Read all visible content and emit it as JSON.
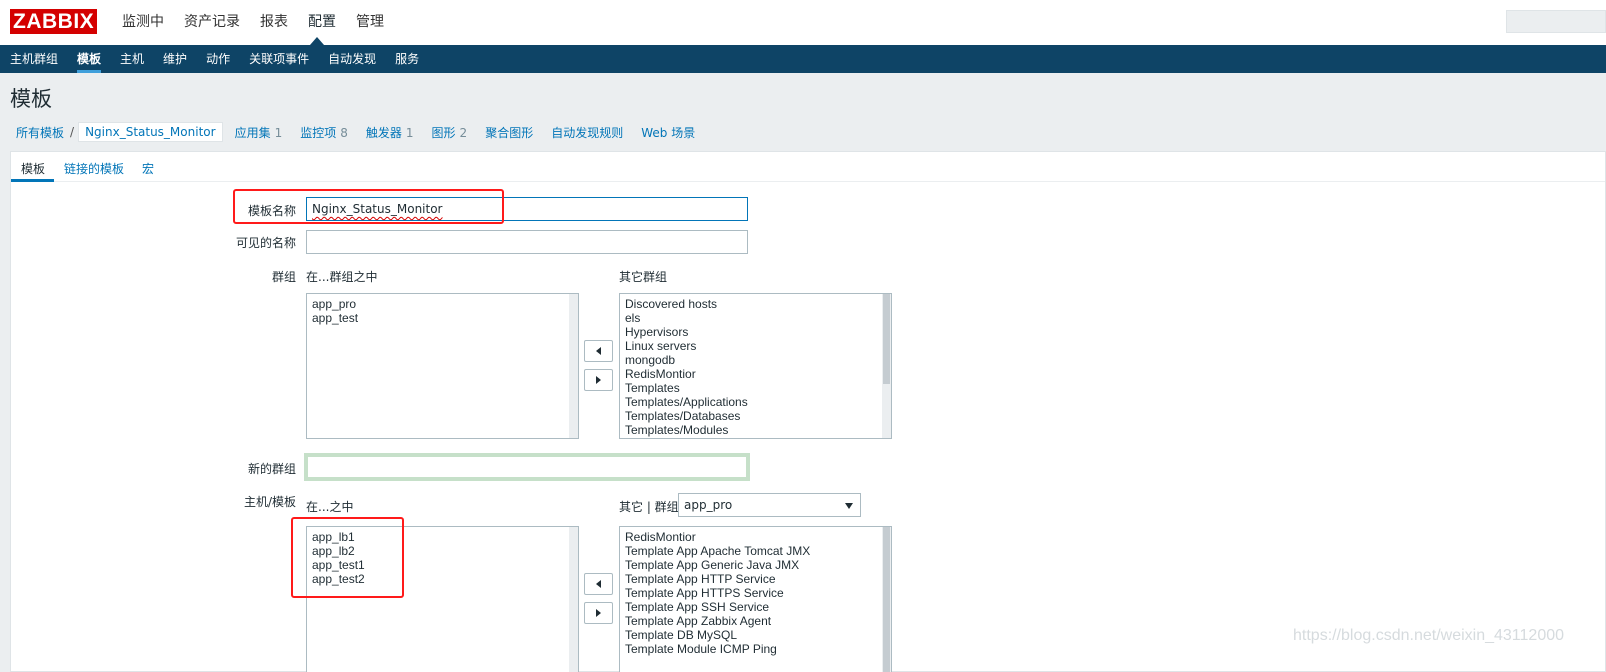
{
  "app": {
    "logo": "ZABBIX"
  },
  "top_menu": {
    "items": [
      "监测中",
      "资产记录",
      "报表",
      "配置",
      "管理"
    ],
    "selected": "配置"
  },
  "sub_menu": {
    "items": [
      "主机群组",
      "模板",
      "主机",
      "维护",
      "动作",
      "关联项事件",
      "自动发现",
      "服务"
    ],
    "selected": "模板"
  },
  "page": {
    "title": "模板"
  },
  "nav": {
    "all_templates": "所有模板",
    "separator": "/",
    "current_template": "Nginx_Status_Monitor",
    "applications": {
      "label": "应用集",
      "count": "1"
    },
    "items": {
      "label": "监控项",
      "count": "8"
    },
    "triggers": {
      "label": "触发器",
      "count": "1"
    },
    "graphs": {
      "label": "图形",
      "count": "2"
    },
    "screens": "聚合图形",
    "discovery": "自动发现规则",
    "web": "Web 场景"
  },
  "tabs": [
    "模板",
    "链接的模板",
    "宏"
  ],
  "form": {
    "template_name": {
      "label": "模板名称",
      "value": "Nginx_Status_Monitor"
    },
    "visible_name": {
      "label": "可见的名称",
      "value": ""
    },
    "groups": {
      "label": "群组",
      "in_label": "在...群组之中",
      "other_label": "其它群组",
      "in_groups": [
        "app_pro",
        "app_test"
      ],
      "other_groups": [
        "Discovered hosts",
        "els",
        "Hypervisors",
        "Linux servers",
        "mongodb",
        "RedisMontior",
        "Templates",
        "Templates/Applications",
        "Templates/Databases",
        "Templates/Modules"
      ]
    },
    "new_group": {
      "label": "新的群组",
      "value": ""
    },
    "hosts": {
      "label": "主机/模板",
      "in_label": "在...之中",
      "other_label": "其它 | 群组",
      "group_select": "app_pro",
      "in_hosts": [
        "app_lb1",
        "app_lb2",
        "app_test1",
        "app_test2"
      ],
      "other_hosts": [
        "RedisMontior",
        "Template App Apache Tomcat JMX",
        "Template App Generic Java JMX",
        "Template App HTTP Service",
        "Template App HTTPS Service",
        "Template App SSH Service",
        "Template App Zabbix Agent",
        "Template DB MySQL",
        "Template Module ICMP Ping"
      ]
    }
  },
  "watermark": "https://blog.csdn.net/weixin_43112000",
  "colors": {
    "header_bg": "#0e4466",
    "link": "#0275b8",
    "logo_bg": "#d40000",
    "highlight": "#ff1a1a"
  }
}
